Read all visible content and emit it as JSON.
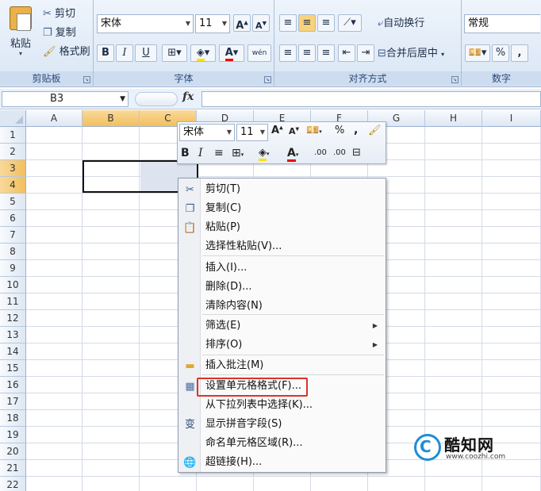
{
  "ribbon": {
    "clipboard": {
      "label": "剪贴板",
      "paste": "粘贴",
      "cut": "剪切",
      "copy": "复制",
      "format_painter": "格式刷"
    },
    "font": {
      "label": "字体",
      "font_name": "宋体",
      "font_size": "11",
      "bold": "B",
      "italic": "I",
      "underline": "U",
      "wen": "wén"
    },
    "alignment": {
      "label": "对齐方式",
      "wrap_text": "自动换行",
      "merge_center": "合并后居中"
    },
    "number": {
      "label": "数字",
      "format": "常规",
      "percent": "%",
      "comma": ","
    }
  },
  "formula_bar": {
    "name_box": "B3",
    "fx": "fx"
  },
  "columns": [
    "A",
    "B",
    "C",
    "D",
    "E",
    "F",
    "G",
    "H",
    "I"
  ],
  "rows": [
    "1",
    "2",
    "3",
    "4",
    "5",
    "6",
    "7",
    "8",
    "9",
    "10",
    "11",
    "12",
    "13",
    "14",
    "15",
    "16",
    "17",
    "18",
    "19",
    "20",
    "21",
    "22"
  ],
  "mini_toolbar": {
    "font_name": "宋体",
    "font_size": "11",
    "percent": "%",
    "comma": ",",
    "bold": "B",
    "italic": "I",
    "inc_decimal": ".00",
    "dec_decimal": ".00"
  },
  "context_menu": {
    "items": [
      {
        "label": "剪切(T)",
        "icon": "scissors-icon"
      },
      {
        "label": "复制(C)",
        "icon": "copy-icon"
      },
      {
        "label": "粘贴(P)",
        "icon": "paste-icon"
      },
      {
        "label": "选择性粘贴(V)...",
        "icon": ""
      },
      {
        "label": "插入(I)...",
        "icon": ""
      },
      {
        "label": "删除(D)...",
        "icon": ""
      },
      {
        "label": "清除内容(N)",
        "icon": ""
      },
      {
        "label": "筛选(E)",
        "icon": "",
        "submenu": true
      },
      {
        "label": "排序(O)",
        "icon": "",
        "submenu": true
      },
      {
        "label": "插入批注(M)",
        "icon": "comment-icon"
      },
      {
        "label": "设置单元格格式(F)...",
        "icon": "format-cells-icon"
      },
      {
        "label": "从下拉列表中选择(K)...",
        "icon": ""
      },
      {
        "label": "显示拼音字段(S)",
        "icon": "phonetic-icon"
      },
      {
        "label": "命名单元格区域(R)...",
        "icon": ""
      },
      {
        "label": "超链接(H)...",
        "icon": "hyperlink-icon"
      }
    ]
  },
  "watermark": {
    "name": "酷知网",
    "url": "www.coozhi.com",
    "logo_letter": "C"
  },
  "colors": {
    "accent_red": "#d9342b",
    "selection_header": "#f1bf5e",
    "watermark_blue": "#1f8dd6"
  }
}
